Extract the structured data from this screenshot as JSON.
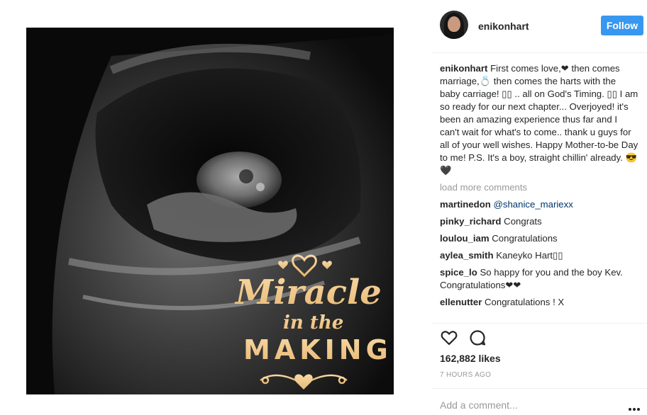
{
  "post": {
    "media_overlay": {
      "line1": "Miracle",
      "line2": "in the",
      "line3": "MAKING"
    },
    "author": "enikonhart",
    "follow_label": "Follow",
    "caption": {
      "username": "enikonhart",
      "text": "First comes love,❤ then comes marriage,💍 then comes the harts with the baby carriage! ▯▯ .. all on God's Timing. ▯▯ I am so ready for our next chapter... Overjoyed! it's been an amazing experience thus far and I can't wait for what's to come.. thank u guys for all of your well wishes. Happy Mother-to-be Day to me! P.S. It's a boy, straight chillin' already. 😎🖤"
    },
    "load_more": "load more comments",
    "comments": [
      {
        "username": "martinedon",
        "text": "@shanice_mariexx",
        "is_mention": true
      },
      {
        "username": "pinky_richard",
        "text": "Congrats"
      },
      {
        "username": "loulou_iam",
        "text": "Congratulations"
      },
      {
        "username": "aylea_smith",
        "text": "Kaneyko Hart▯▯"
      },
      {
        "username": "spice_lo",
        "text": "So happy for you and the boy Kev. Congratulations❤❤"
      },
      {
        "username": "ellenutter",
        "text": "Congratulations ! X"
      }
    ],
    "likes": "162,882 likes",
    "time": "7 HOURS AGO",
    "add_comment_placeholder": "Add a comment...",
    "more_label": "···"
  },
  "icons": {
    "like": "heart-outline-icon",
    "comment": "speech-bubble-icon",
    "more": "ellipsis-icon"
  },
  "colors": {
    "follow_button": "#3897f0",
    "overlay_text": "#f2c98f",
    "mention": "#003569",
    "muted": "#999999"
  }
}
